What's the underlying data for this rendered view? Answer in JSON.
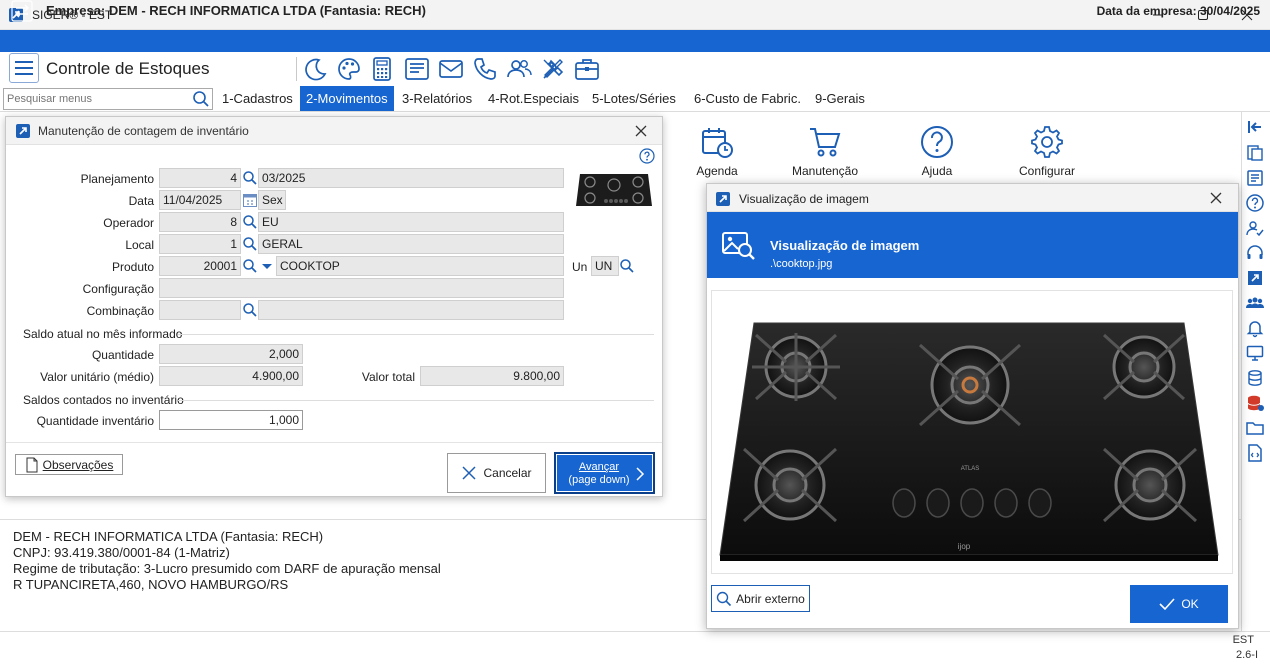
{
  "window": {
    "title": "SIGER® - EST"
  },
  "company": {
    "name": "Empresa: DEM - RECH INFORMATICA LTDA (Fantasia: RECH)",
    "date": "Data da empresa: 30/04/2025"
  },
  "header": {
    "title": "Controle de Estoques"
  },
  "search": {
    "placeholder": "Pesquisar menus"
  },
  "menu": [
    {
      "label": "1-Cadastros"
    },
    {
      "label": "2-Movimentos",
      "active": true
    },
    {
      "label": "3-Relatórios"
    },
    {
      "label": "4-Rot.Especiais"
    },
    {
      "label": "5-Lotes/Séries"
    },
    {
      "label": "6-Custo de Fabric."
    },
    {
      "label": "9-Gerais"
    }
  ],
  "launcher": [
    {
      "label": "Agenda",
      "icon": "calendar-clock-icon"
    },
    {
      "label": "Manutenção",
      "icon": "cart-icon"
    },
    {
      "label": "Ajuda",
      "icon": "help-icon"
    },
    {
      "label": "Configurar",
      "icon": "gear-icon"
    }
  ],
  "inventory_dialog": {
    "title": "Manutenção de contagem de inventário",
    "fields": {
      "planejamento": {
        "label": "Planejamento",
        "code": "4",
        "value": "03/2025"
      },
      "data": {
        "label": "Data",
        "value": "11/04/2025",
        "weekday": "Sex"
      },
      "operador": {
        "label": "Operador",
        "code": "8",
        "value": "EU"
      },
      "local": {
        "label": "Local",
        "code": "1",
        "value": "GERAL"
      },
      "produto": {
        "label": "Produto",
        "code": "20001",
        "value": "COOKTOP",
        "unit_label": "Un",
        "unit": "UN"
      },
      "configuracao": {
        "label": "Configuração",
        "value": ""
      },
      "combinacao": {
        "label": "Combinação",
        "code": "",
        "value": ""
      }
    },
    "saldo_atual": {
      "section": "Saldo atual no mês informado",
      "quantidade_label": "Quantidade",
      "quantidade": "2,000",
      "valor_unitario_label": "Valor unitário (médio)",
      "valor_unitario": "4.900,00",
      "valor_total_label": "Valor total",
      "valor_total": "9.800,00"
    },
    "saldos_contados": {
      "section": "Saldos contados no inventário",
      "quantidade_label": "Quantidade inventário",
      "quantidade": "1,000"
    },
    "buttons": {
      "observacoes": "Observações",
      "cancelar": "Cancelar",
      "avancar": "Avançar",
      "avancar_sub": "(page down)"
    }
  },
  "image_dialog": {
    "title": "Visualização de imagem",
    "heading": "Visualização de imagem",
    "file": ".\\cooktop.jpg",
    "brand": "ATLAS",
    "brand_bottom": "ijop",
    "buttons": {
      "open_external": "Abrir externo",
      "ok": "OK"
    }
  },
  "status": {
    "lines": [
      "DEM - RECH INFORMATICA LTDA (Fantasia: RECH)",
      "CNPJ: 93.419.380/0001-84 (1-Matriz)",
      "Regime de tributação: 3-Lucro presumido com DARF de apuração mensal",
      "R TUPANCIRETA,460, NOVO HAMBURGO/RS"
    ]
  },
  "footer": {
    "code": "EST",
    "version": "2.6-I"
  },
  "colors": {
    "accent": "#1765d0",
    "field_bg": "#e8e8e8",
    "icon": "#1d5fb5"
  }
}
